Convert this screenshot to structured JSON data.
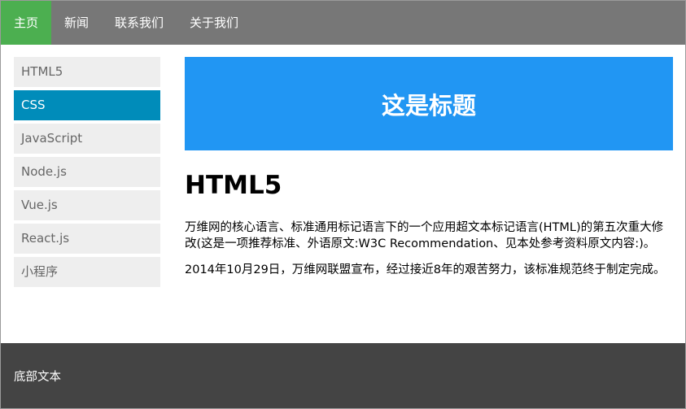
{
  "topnav": {
    "items": [
      {
        "label": "主页",
        "active": true
      },
      {
        "label": "新闻",
        "active": false
      },
      {
        "label": "联系我们",
        "active": false
      },
      {
        "label": "关于我们",
        "active": false
      }
    ]
  },
  "sidebar": {
    "items": [
      {
        "label": "HTML5",
        "active": false
      },
      {
        "label": "CSS",
        "active": true
      },
      {
        "label": "JavaScript",
        "active": false
      },
      {
        "label": "Node.js",
        "active": false
      },
      {
        "label": "Vue.js",
        "active": false
      },
      {
        "label": "React.js",
        "active": false
      },
      {
        "label": "小程序",
        "active": false
      }
    ]
  },
  "banner": {
    "title": "这是标题"
  },
  "main": {
    "heading": "HTML5",
    "paragraphs": [
      "万维网的核心语言、标准通用标记语言下的一个应用超文本标记语言(HTML)的第五次重大修改(这是一项推荐标准、外语原文:W3C Recommendation、见本处参考资料原文内容:)。",
      "2014年10月29日，万维网联盟宣布，经过接近8年的艰苦努力，该标准规范终于制定完成。"
    ]
  },
  "footer": {
    "text": "底部文本"
  },
  "colors": {
    "topnav_bg": "#777777",
    "topnav_active": "#4caf50",
    "sidebar_item_bg": "#eeeeee",
    "sidebar_active": "#008cba",
    "banner_bg": "#2196f3",
    "footer_bg": "#444444"
  }
}
